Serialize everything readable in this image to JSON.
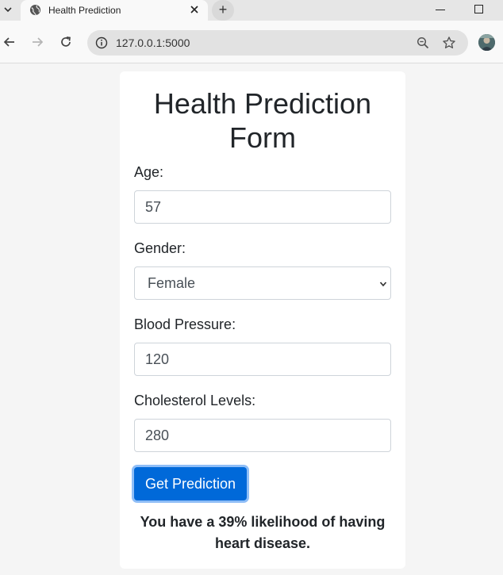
{
  "browser": {
    "tab_title": "Health Prediction",
    "new_tab_label": "+",
    "url": "127.0.0.1:5000"
  },
  "form": {
    "title": "Health Prediction Form",
    "age": {
      "label": "Age:",
      "value": "57"
    },
    "gender": {
      "label": "Gender:",
      "value": "Female"
    },
    "blood_pressure": {
      "label": "Blood Pressure:",
      "value": "120"
    },
    "cholesterol": {
      "label": "Cholesterol Levels:",
      "value": "280"
    },
    "submit_label": "Get Prediction",
    "result": "You have a 39% likelihood of having heart disease."
  },
  "colors": {
    "primary_button": "#0069d9",
    "page_background": "#f5f5f5"
  }
}
